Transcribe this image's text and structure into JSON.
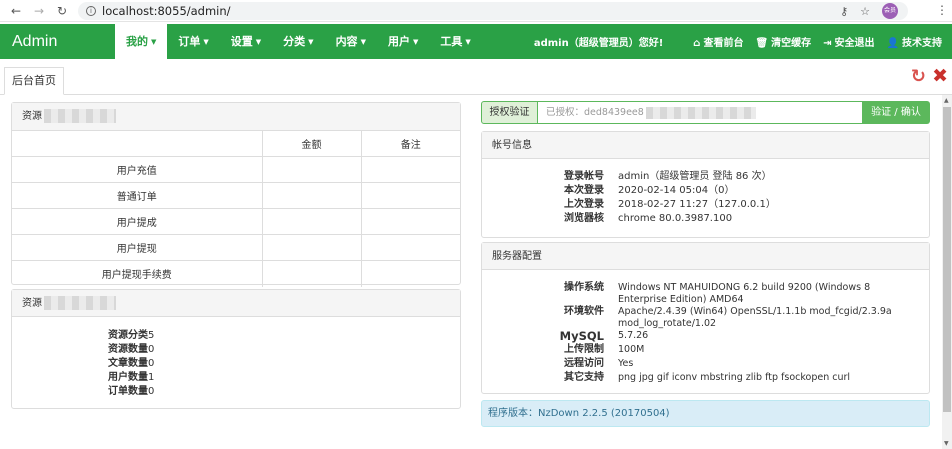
{
  "browser": {
    "url": "localhost:8055/admin/",
    "profile_label": "会员"
  },
  "navbar": {
    "brand": "Admin",
    "menu": [
      {
        "label": "我的",
        "active": true
      },
      {
        "label": "订单",
        "active": false
      },
      {
        "label": "设置",
        "active": false
      },
      {
        "label": "分类",
        "active": false
      },
      {
        "label": "内容",
        "active": false
      },
      {
        "label": "用户",
        "active": false
      },
      {
        "label": "工具",
        "active": false
      }
    ],
    "user_text": "admin（超级管理员）您好!",
    "links": [
      "查看前台",
      "清空缓存",
      "安全退出",
      "技术支持"
    ]
  },
  "tabs": {
    "home": "后台首页"
  },
  "resource_panel": {
    "title": "资源",
    "columns": [
      "",
      "金额",
      "备注"
    ],
    "rows": [
      "用户充值",
      "普通订单",
      "用户提成",
      "用户提现",
      "用户提现手续费"
    ]
  },
  "stats_panel": {
    "title": "资源",
    "items": [
      {
        "label": "资源分类",
        "value": "5"
      },
      {
        "label": "资源数量",
        "value": "0"
      },
      {
        "label": "文章数量",
        "value": "0"
      },
      {
        "label": "用户数量",
        "value": "1"
      },
      {
        "label": "订单数量",
        "value": "0"
      }
    ]
  },
  "auth": {
    "label": "授权验证",
    "input_value": "已授权：ded8439ee8",
    "button": "验证 / 确认"
  },
  "account_panel": {
    "title": "帐号信息",
    "items": [
      {
        "label": "登录帐号",
        "value": "admin（超级管理员 登陆 86 次）"
      },
      {
        "label": "本次登录",
        "value": "2020-02-14 05:04（0）"
      },
      {
        "label": "上次登录",
        "value": "2018-02-27 11:27（127.0.0.1）"
      },
      {
        "label": "浏览器核",
        "value": "chrome 80.0.3987.100"
      }
    ]
  },
  "server_panel": {
    "title": "服务器配置",
    "items": [
      {
        "label": "操作系统",
        "value": "Windows NT MAHUIDONG 6.2 build 9200 (Windows 8 Enterprise Edition) AMD64"
      },
      {
        "label": "环境软件",
        "value": "Apache/2.4.39 (Win64) OpenSSL/1.1.1b mod_fcgid/2.3.9a mod_log_rotate/1.02"
      },
      {
        "label": "MySQL",
        "value": "5.7.26"
      },
      {
        "label": "上传限制",
        "value": "100M"
      },
      {
        "label": "远程访问",
        "value": "Yes"
      },
      {
        "label": "其它支持",
        "value": "png jpg gif iconv mbstring zlib ftp fsockopen curl"
      }
    ]
  },
  "version": "程序版本：NzDown 2.2.5 (20170504)",
  "colors": {
    "navbar": "#2aa146",
    "auth_green": "#5cb85c",
    "refresh_red": "#d9534f",
    "version_bg": "#d9edf7"
  }
}
